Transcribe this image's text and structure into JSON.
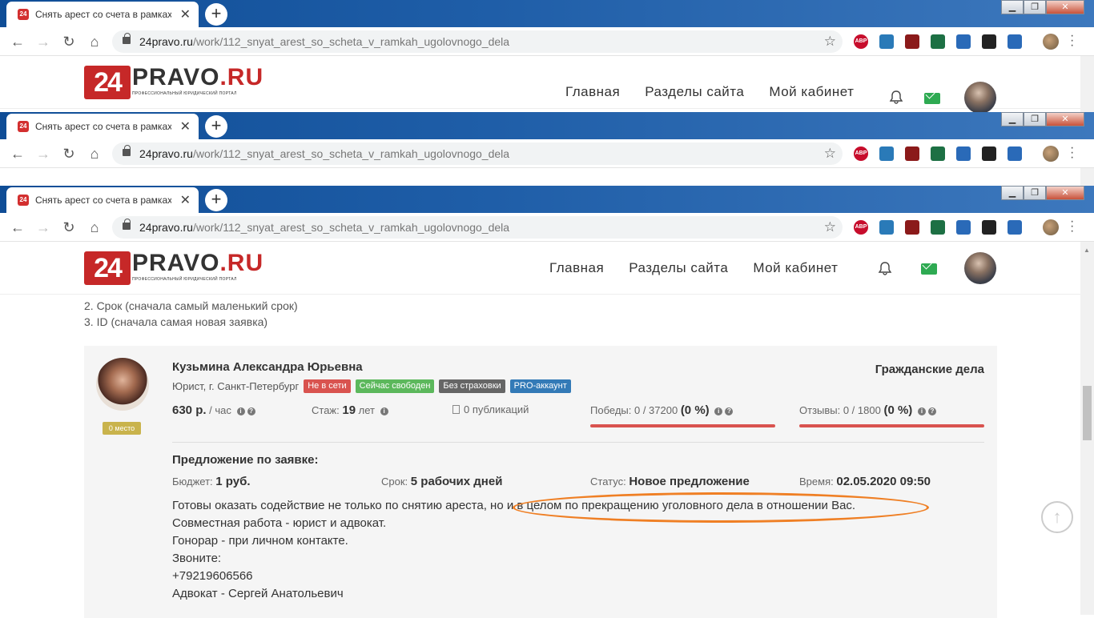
{
  "browser": {
    "tab_title": "Снять арест со счета в рамках у",
    "tab_favicon": "24",
    "new_tab_label": "+",
    "tab_close": "✕",
    "url_domain": "24pravo.ru",
    "url_path": "/work/112_snyat_arest_so_scheta_v_ramkah_ugolovnogo_dela",
    "extensions": [
      {
        "name": "adblock-plus-icon",
        "label": "ABP",
        "color": "#c70d2c"
      },
      {
        "name": "screenshot-ext-icon",
        "label": "",
        "color": "#2a7ab8"
      },
      {
        "name": "pdf-ext-icon",
        "label": "",
        "color": "#8b1a1a"
      },
      {
        "name": "excel-ext-icon",
        "label": "",
        "color": "#1d7044"
      },
      {
        "name": "acrobat-ext-icon",
        "label": "",
        "color": "#2a6ab8"
      },
      {
        "name": "tabs-ext-icon",
        "label": "",
        "color": "#222222"
      },
      {
        "name": "download-ext-icon",
        "label": "",
        "color": "#2a6ab8"
      }
    ]
  },
  "site": {
    "logo_number": "24",
    "logo_text_main": "PRAVO",
    "logo_text_tld": ".RU",
    "logo_tagline": "ПРОФЕССИОНАЛЬНЫЙ ЮРИДИЧЕСКИЙ ПОРТАЛ",
    "nav": [
      "Главная",
      "Разделы сайта",
      "Мой кабинет"
    ]
  },
  "sort_options": [
    "2. Срок (сначала самый маленький срок)",
    "3. ID (сначала самая новая заявка)"
  ],
  "lawyer": {
    "name": "Кузьмина Александра Юрьевна",
    "category": "Гражданские дела",
    "role": "Юрист, г. Санкт-Петербург",
    "place": "0 место",
    "badges": [
      {
        "label": "Не в сети",
        "color": "#d9534f"
      },
      {
        "label": "Сейчас свободен",
        "color": "#5cb85c"
      },
      {
        "label": "Без страховки",
        "color": "#666666"
      },
      {
        "label": "PRO-аккаунт",
        "color": "#337ab7"
      }
    ],
    "rate_value": "630 р.",
    "rate_unit": "/ час",
    "experience_label": "Стаж:",
    "experience_value": "19",
    "experience_unit": "лет",
    "publications": "0 публикаций",
    "wins_label": "Победы: 0 / 37200",
    "wins_pct": "(0 %)",
    "reviews_label": "Отзывы: 0 / 1800",
    "reviews_pct": "(0 %)"
  },
  "offer": {
    "title": "Предложение по заявке:",
    "budget_label": "Бюджет:",
    "budget_value": "1 руб.",
    "term_label": "Срок:",
    "term_value": "5 рабочих дней",
    "status_label": "Статус:",
    "status_value": "Новое предложение",
    "time_label": "Время:",
    "time_value": "02.05.2020 09:50",
    "message": "Готовы оказать содействие не только по снятию ареста, но и в целом по прекращению уголовного дела в отношении Вас.\nСовместная работа - юрист и адвокат.\nГонорар - при личном контакте.\nЗвоните:\n+79219606566\nАдвокат - Сергей Анатольевич"
  },
  "accent_color": "#ef7f24"
}
